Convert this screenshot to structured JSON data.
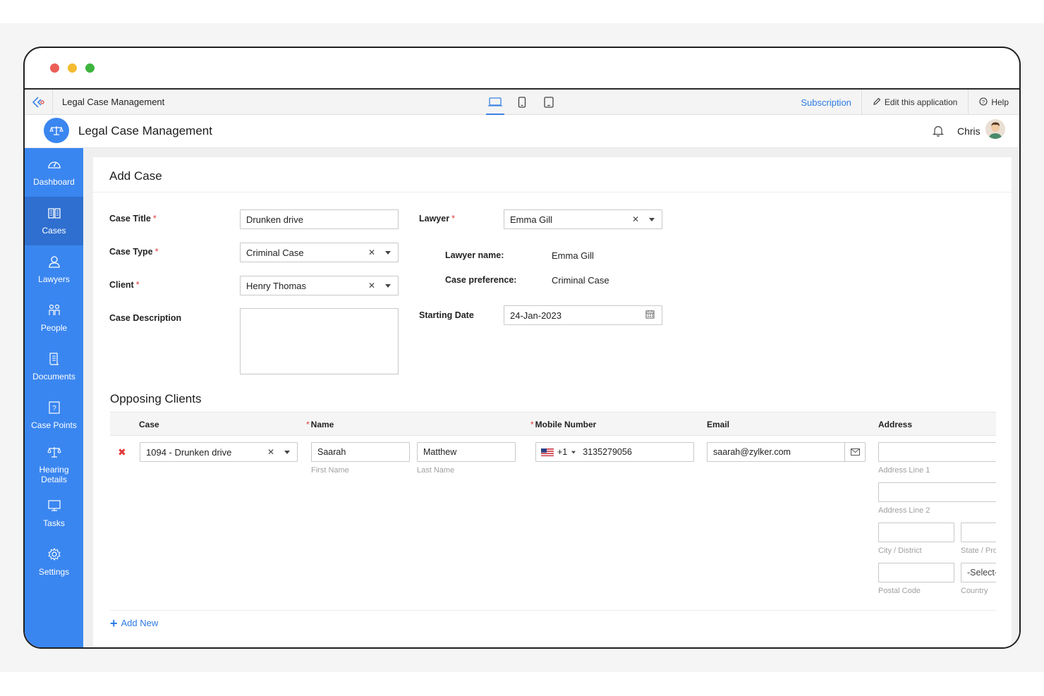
{
  "window": {
    "dot_colors": [
      "#ec5f57",
      "#f3bc30",
      "#3db53f"
    ]
  },
  "topbar": {
    "app_title": "Legal Case Management",
    "subscription": "Subscription",
    "edit_app": "Edit this application",
    "help": "Help",
    "accent": "#3b82e6"
  },
  "header": {
    "title": "Legal Case Management",
    "user_name": "Chris"
  },
  "sidebar": {
    "color": "#3a86f0",
    "items": [
      {
        "label": "Dashboard",
        "icon": "dashboard-icon"
      },
      {
        "label": "Cases",
        "icon": "cases-icon"
      },
      {
        "label": "Lawyers",
        "icon": "lawyers-icon"
      },
      {
        "label": "People",
        "icon": "people-icon"
      },
      {
        "label": "Documents",
        "icon": "documents-icon"
      },
      {
        "label": "Case Points",
        "icon": "case-points-icon"
      },
      {
        "label": "Hearing Details",
        "icon": "hearing-details-icon"
      },
      {
        "label": "Tasks",
        "icon": "tasks-icon"
      },
      {
        "label": "Settings",
        "icon": "settings-icon"
      }
    ],
    "active": "Cases"
  },
  "form": {
    "title": "Add Case",
    "case_title": {
      "label": "Case Title",
      "value": "Drunken drive"
    },
    "case_type": {
      "label": "Case Type",
      "value": "Criminal Case"
    },
    "client": {
      "label": "Client",
      "value": "Henry Thomas"
    },
    "case_description": {
      "label": "Case Description",
      "value": ""
    },
    "lawyer": {
      "label": "Lawyer",
      "value": "Emma Gill"
    },
    "lawyer_name": {
      "label": "Lawyer name:",
      "value": "Emma Gill"
    },
    "case_preference": {
      "label": "Case preference:",
      "value": "Criminal Case"
    },
    "starting_date": {
      "label": "Starting Date",
      "value": "24-Jan-2023"
    },
    "required_mark": "*"
  },
  "opposing": {
    "title": "Opposing Clients",
    "columns": {
      "case": "Case",
      "name": "Name",
      "mobile": "Mobile Number",
      "email": "Email",
      "address": "Address"
    },
    "row": {
      "case": "1094 - Drunken drive",
      "first_name": "Saarah",
      "last_name": "Matthew",
      "first_name_label": "First Name",
      "last_name_label": "Last Name",
      "country_code": "+1",
      "phone": "3135279056",
      "email": "saarah@zylker.com",
      "address_line1_label": "Address Line 1",
      "address_line2_label": "Address Line 2",
      "city_label": "City / District",
      "state_label": "State / Pro",
      "postal_label": "Postal Code",
      "country_label": "Country",
      "country_value": "-Select-"
    },
    "add_new": "Add New",
    "remove_color": "#e23b3b"
  }
}
